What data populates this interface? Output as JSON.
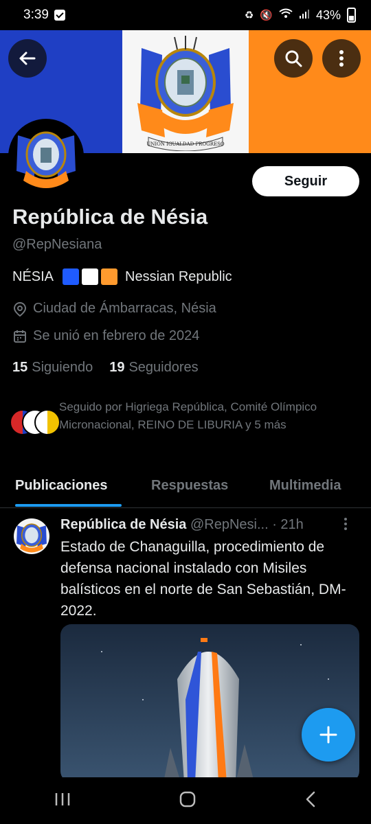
{
  "status_bar": {
    "time": "3:39",
    "battery": "43%"
  },
  "profile": {
    "name": "República de Nésia",
    "handle": "@RepNesiana",
    "bio_prefix": "NÉSIA",
    "bio_suffix": "Nessian Republic",
    "location": "Ciudad de Ámbarracas, Nésia",
    "joined": "Se unió en febrero de 2024",
    "following_count": "15",
    "following_label": "Siguiendo",
    "followers_count": "19",
    "followers_label": "Seguidores",
    "follow_button": "Seguir",
    "followed_by": "Seguido por Higriega República, Comité Olímpico Micronacional, REINO DE LIBURIA y 5 más",
    "flag_colors": [
      "#1f5bff",
      "#ffffff",
      "#ff9a2e"
    ]
  },
  "banner": {
    "motto": "UNIÓN   IGUALDAD   PROGRESO",
    "crest_ring_text": "REPÚBLICA NESIANA"
  },
  "tabs": [
    {
      "label": "Publicaciones",
      "active": true
    },
    {
      "label": "Respuestas",
      "active": false
    },
    {
      "label": "Multimedia",
      "active": false
    }
  ],
  "post": {
    "author": "República de Nésia",
    "handle": "@RepNesi...",
    "time": "· 21h",
    "text": "Estado de Chanaguilla, procedimiento de defensa nacional instalado con Misiles balísticos en el norte de San Sebastián, DM-2022."
  },
  "icons": {
    "back": "arrow-left-icon",
    "search": "search-icon",
    "more": "more-vertical-icon",
    "location": "location-pin-icon",
    "calendar": "calendar-icon",
    "compose": "plus-icon"
  },
  "colors": {
    "accent": "#1d9bf0",
    "muted": "#71767b"
  }
}
